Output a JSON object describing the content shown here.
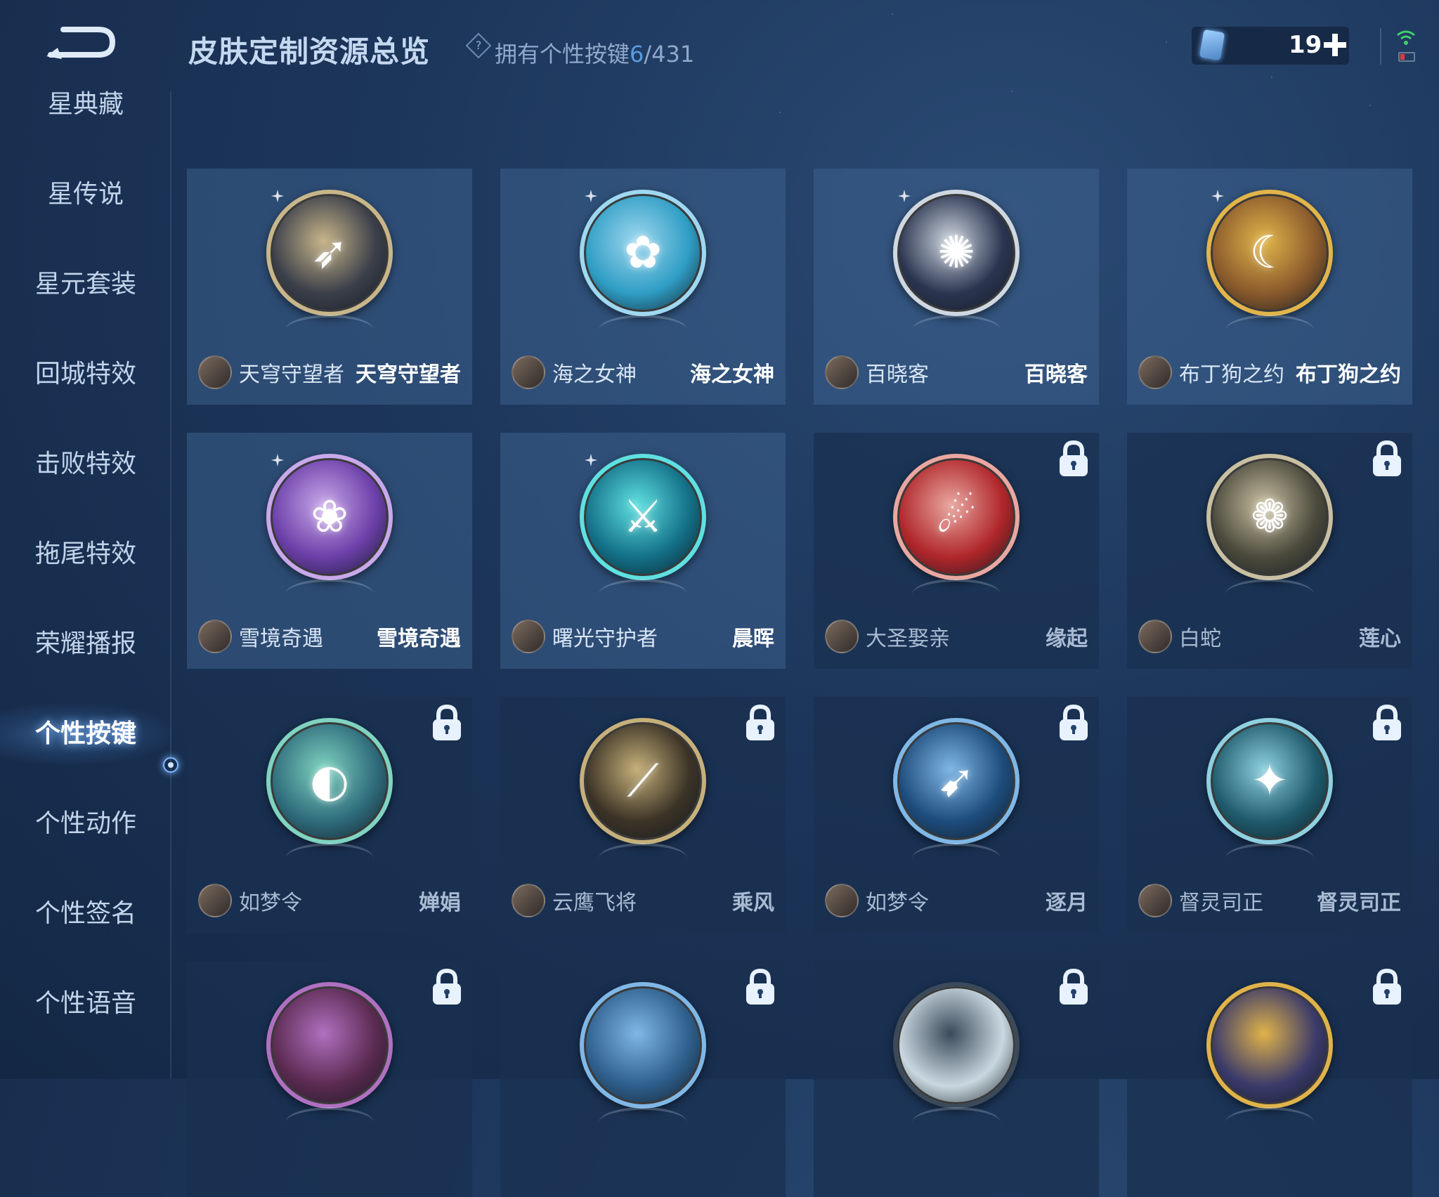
{
  "header": {
    "title": "皮肤定制资源总览",
    "help_glyph": "?",
    "owned_label": "拥有个性按键",
    "owned_count": "6",
    "owned_total": "/431",
    "currency_value": "19",
    "add_glyph": "+"
  },
  "sidebar": {
    "items": [
      {
        "label": "星典藏"
      },
      {
        "label": "星传说"
      },
      {
        "label": "星元套装"
      },
      {
        "label": "回城特效"
      },
      {
        "label": "击败特效"
      },
      {
        "label": "拖尾特效"
      },
      {
        "label": "荣耀播报"
      },
      {
        "label": "个性按键",
        "active": true
      },
      {
        "label": "个性动作"
      },
      {
        "label": "个性签名"
      },
      {
        "label": "个性语音"
      }
    ]
  },
  "cards": [
    {
      "hero": "天穹守望者",
      "skin": "天穹守望者",
      "locked": false,
      "glyph": "➶",
      "color": "#3b3f4a",
      "ring": "#c8b68a"
    },
    {
      "hero": "海之女神",
      "skin": "海之女神",
      "locked": false,
      "glyph": "✿",
      "color": "#2f9dc4",
      "ring": "#9fd8f0"
    },
    {
      "hero": "百晓客",
      "skin": "百晓客",
      "locked": false,
      "glyph": "✺",
      "color": "#2b3550",
      "ring": "#cfd7e0"
    },
    {
      "hero": "布丁狗之约",
      "skin": "布丁狗之约",
      "locked": false,
      "glyph": "☾",
      "color": "#8a5a2c",
      "ring": "#e2b54a"
    },
    {
      "hero": "雪境奇遇",
      "skin": "雪境奇遇",
      "locked": false,
      "glyph": "❀",
      "color": "#6b3fa8",
      "ring": "#c9a8ea"
    },
    {
      "hero": "曙光守护者",
      "skin": "晨晖",
      "locked": false,
      "glyph": "⚔",
      "color": "#137088",
      "ring": "#5fe0e0"
    },
    {
      "hero": "大圣娶亲",
      "skin": "缘起",
      "locked": true,
      "glyph": "☄",
      "color": "#b0262a",
      "ring": "#e9a7a0"
    },
    {
      "hero": "白蛇",
      "skin": "莲心",
      "locked": true,
      "glyph": "❁",
      "color": "#4b4a3c",
      "ring": "#c9c0a2"
    },
    {
      "hero": "如梦令",
      "skin": "婵娟",
      "locked": true,
      "glyph": "◐",
      "color": "#2f6c7c",
      "ring": "#7fd3c0"
    },
    {
      "hero": "云鹰飞将",
      "skin": "乘风",
      "locked": true,
      "glyph": "⟋",
      "color": "#3b3326",
      "ring": "#c6b07a"
    },
    {
      "hero": "如梦令",
      "skin": "逐月",
      "locked": true,
      "glyph": "➹",
      "color": "#1d4c7c",
      "ring": "#7fb7e6"
    },
    {
      "hero": "督灵司正",
      "skin": "督灵司正",
      "locked": true,
      "glyph": "✦",
      "color": "#1f5b6c",
      "ring": "#8ed0e0"
    },
    {
      "hero": "",
      "skin": "",
      "locked": true,
      "glyph": "",
      "color": "#5a2a50",
      "ring": "#b070c0"
    },
    {
      "hero": "",
      "skin": "",
      "locked": true,
      "glyph": "",
      "color": "#2e5f8c",
      "ring": "#7fb7e6"
    },
    {
      "hero": "",
      "skin": "",
      "locked": true,
      "glyph": "",
      "color": "#c9d8e0",
      "ring": "#3a4a5a"
    },
    {
      "hero": "",
      "skin": "",
      "locked": true,
      "glyph": "",
      "color": "#3b3a6a",
      "ring": "#e0b34a"
    }
  ]
}
